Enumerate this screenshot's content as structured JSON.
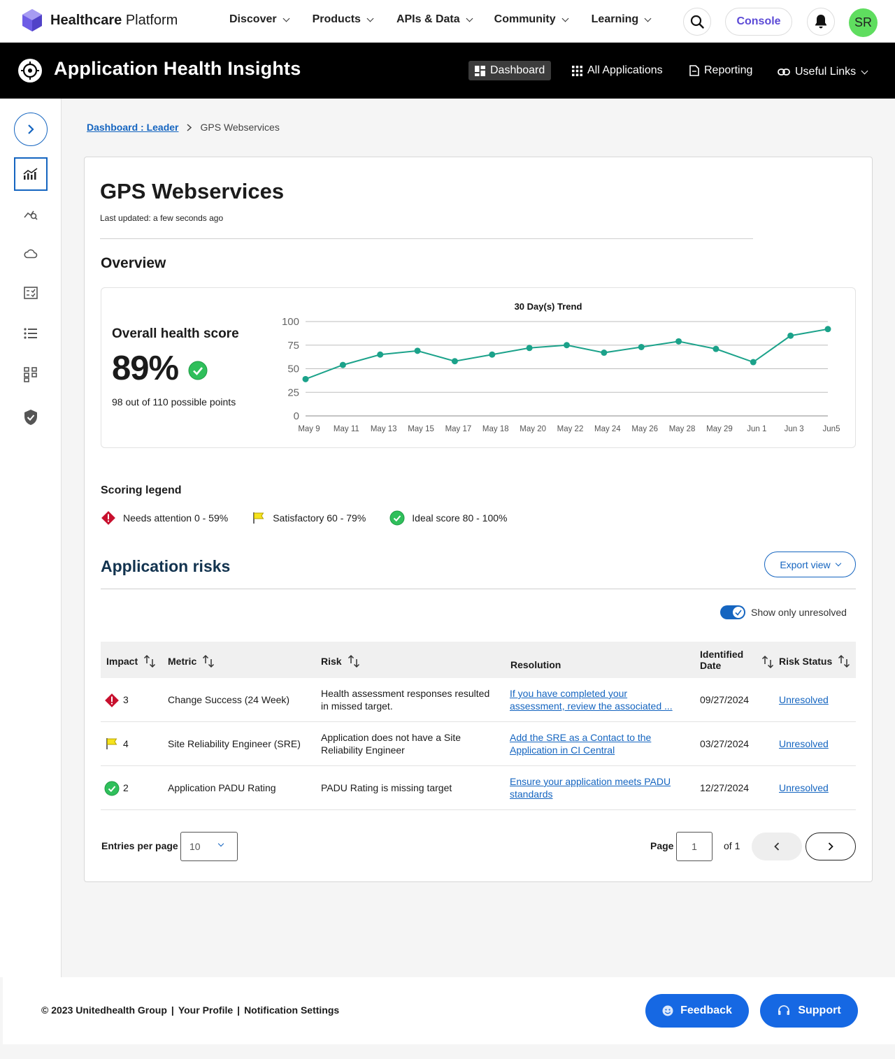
{
  "topnav": {
    "brand_bold": "Healthcare",
    "brand_rest": "Platform",
    "items": [
      "Discover",
      "Products",
      "APIs & Data",
      "Community",
      "Learning"
    ],
    "console_label": "Console",
    "avatar_initials": "SR"
  },
  "appbar": {
    "title": "Application Health Insights",
    "tabs": {
      "dashboard": "Dashboard",
      "all_apps": "All Applications",
      "reporting": "Reporting",
      "links": "Useful Links"
    }
  },
  "breadcrumb": {
    "parent": "Dashboard : Leader",
    "current": "GPS Webservices"
  },
  "page": {
    "title": "GPS Webservices",
    "updated": "Last updated: a few seconds ago",
    "overview": "Overview"
  },
  "health": {
    "label": "Overall health score",
    "score": "89%",
    "points": "98 out of  110 possible points"
  },
  "chart_data": {
    "type": "line",
    "title": "30 Day(s) Trend",
    "categories": [
      "May 9",
      "May 11",
      "May 13",
      "May 15",
      "May 17",
      "May 18",
      "May 20",
      "May 22",
      "May 24",
      "May 26",
      "May 28",
      "May 29",
      "Jun 1",
      "Jun 3",
      "Jun5"
    ],
    "values": [
      39,
      54,
      65,
      69,
      58,
      65,
      72,
      75,
      67,
      73,
      79,
      71,
      57,
      85,
      92
    ],
    "ylim": [
      0,
      100
    ],
    "yticks": [
      0,
      25,
      50,
      75,
      100
    ],
    "grid": true,
    "color": "#1ba28a"
  },
  "legend": {
    "title": "Scoring legend",
    "items": {
      "attention": "Needs attention 0 - 59%",
      "satisfactory": "Satisfactory 60 - 79%",
      "ideal": "Ideal score 80 - 100%"
    }
  },
  "risks": {
    "title": "Application risks",
    "export_label": "Export view",
    "toggle_label": "Show only unresolved",
    "toggle_on": true,
    "headers": {
      "impact": "Impact",
      "metric": "Metric",
      "risk": "Risk",
      "resolution": "Resolution",
      "date_line1": "Identified",
      "date_line2": "Date",
      "status": "Risk Status"
    },
    "rows": [
      {
        "icon": "alert-diamond-icon",
        "impact": "3",
        "metric": "Change Success (24 Week)",
        "risk_l1": "Health assessment responses resulted",
        "risk_l2": "in missed target.",
        "res_l1": "If you have completed your",
        "res_l2": "assessment, review the associated ...",
        "date": "09/27/2024",
        "status": "Unresolved"
      },
      {
        "icon": "flag-icon",
        "impact": "4",
        "metric": "Site Reliability Engineer (SRE)",
        "risk_l1": "Application does not have a Site",
        "risk_l2": "Reliability Engineer",
        "res_l1": "Add the SRE as a Contact to the",
        "res_l2": "Application in CI Central",
        "date": "03/27/2024",
        "status": "Unresolved"
      },
      {
        "icon": "check-circle-icon",
        "impact": "2",
        "metric": "Application PADU Rating",
        "risk_l1": "PADU Rating is missing target",
        "risk_l2": "",
        "res_l1": "Ensure your application meets PADU",
        "res_l2": "standards",
        "date": "12/27/2024",
        "status": "Unresolved"
      }
    ]
  },
  "pagination": {
    "entries_label": "Entries per page",
    "entries_value": "10",
    "page_label": "Page",
    "page_value": "1",
    "of_label": "of 1"
  },
  "footer": {
    "copyright": "© 2023 Unitedhealth Group",
    "sep": "|",
    "profile": "Your Profile",
    "notifications": "Notification Settings",
    "feedback": "Feedback",
    "support": "Support"
  }
}
